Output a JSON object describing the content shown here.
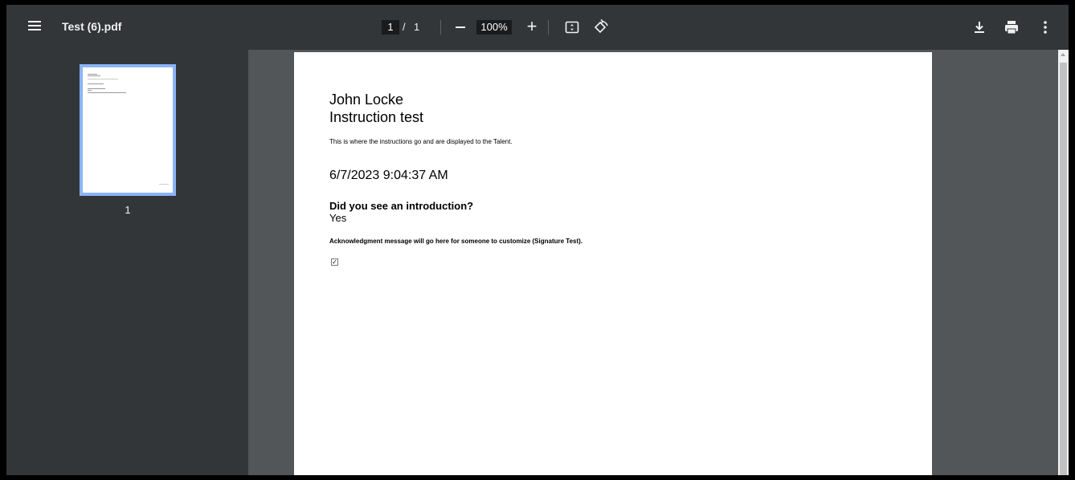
{
  "toolbar": {
    "title": "Test (6).pdf",
    "page_current": "1",
    "page_separator": "/",
    "page_total": "1",
    "zoom": "100%",
    "zoom_in_label": "+",
    "icons": [
      "menu-icon",
      "zoom-out-icon",
      "zoom-in-icon",
      "fit-to-page-icon",
      "rotate-icon",
      "download-icon",
      "print-icon",
      "more-vert-icon"
    ]
  },
  "sidebar": {
    "thumbnail_number": "1",
    "thumbnail_selected_color": "#8ab4f8"
  },
  "document": {
    "name": "John Locke",
    "title": "Instruction test",
    "instructions": "This is where the instructions go and are displayed to the Talent.",
    "datetime": "6/7/2023 9:04:37 AM",
    "question": "Did you see an introduction?",
    "answer": "Yes",
    "acknowledgment": "Acknowledgment message will go here for someone to customize (Signature Test).",
    "checkbox_checked": true,
    "checkbox_mark": "✓"
  },
  "colors": {
    "toolbar_bg": "#323639",
    "viewer_bg": "#525659",
    "page_bg": "#ffffff"
  }
}
